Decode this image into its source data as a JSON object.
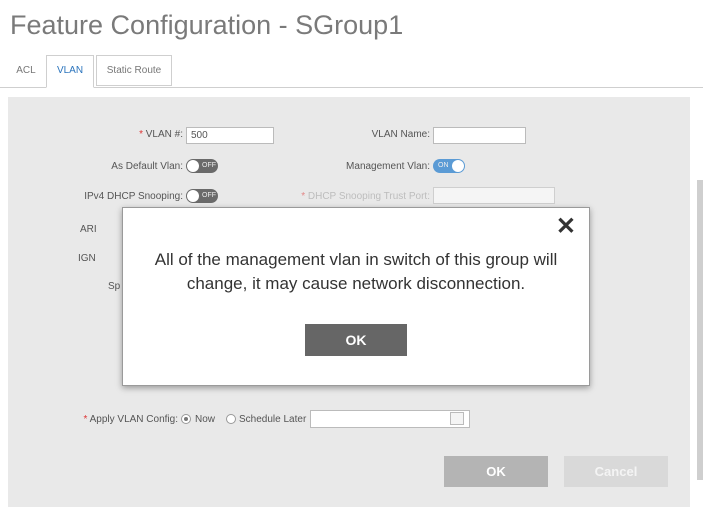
{
  "page": {
    "title": "Feature Configuration - SGroup1"
  },
  "tabs": [
    {
      "label": "ACL"
    },
    {
      "label": "VLAN"
    },
    {
      "label": "Static Route"
    }
  ],
  "form": {
    "vlan_id_label": "VLAN #:",
    "vlan_id_value": "500",
    "vlan_name_label": "VLAN Name:",
    "vlan_name_value": "",
    "as_default_vlan_label": "As Default Vlan:",
    "as_default_vlan_state": "OFF",
    "management_vlan_label": "Management Vlan:",
    "management_vlan_state": "ON",
    "ipv4_dhcp_snooping_label": "IPv4 DHCP Snooping:",
    "ipv4_dhcp_snooping_state": "OFF",
    "dhcp_trust_port_label": "DHCP Snooping Trust Port:",
    "arp_label_partial": "ARI",
    "igmp_label_partial": "IGN",
    "spanning_label_partial": "Sp",
    "apply_label": "Apply VLAN Config:",
    "apply_option_now": "Now",
    "apply_option_later": "Schedule Later"
  },
  "footer": {
    "ok_label": "OK",
    "cancel_label": "Cancel"
  },
  "modal": {
    "close_symbol": "✕",
    "message": "All of the management vlan in switch of this group will change, it may cause network disconnection.",
    "ok_label": "OK"
  },
  "colors": {
    "accent": "#2b74bd",
    "toggle_on": "#5b9bd5",
    "button_dark": "#666666"
  }
}
